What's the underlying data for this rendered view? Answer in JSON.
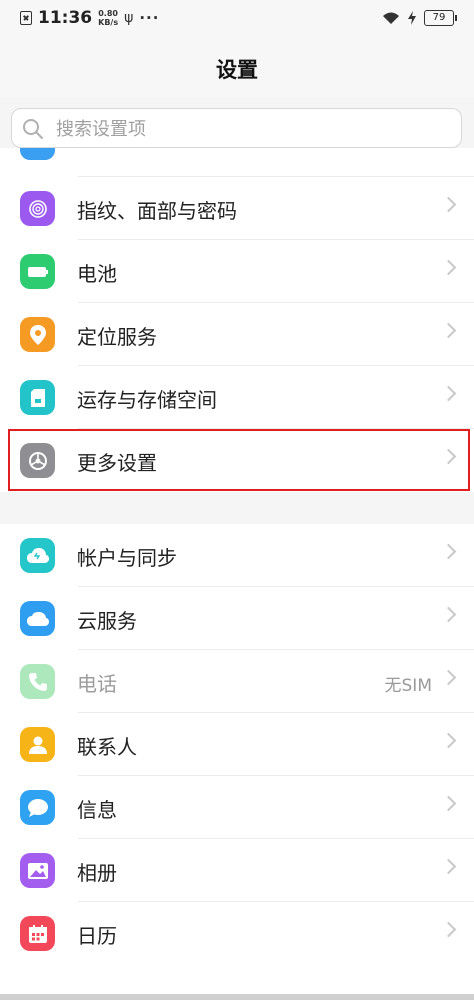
{
  "status_bar": {
    "time": "11:36",
    "speed_value": "0.80",
    "speed_unit": "KB/s",
    "battery": "79",
    "more_indicator": "···"
  },
  "header": {
    "title": "设置"
  },
  "search": {
    "placeholder": "搜索设置项"
  },
  "group1": [
    {
      "label": "指纹、面部与密码",
      "icon": "fingerprint-icon",
      "color": "#9b59f0"
    },
    {
      "label": "电池",
      "icon": "battery-icon",
      "color": "#2ecc71"
    },
    {
      "label": "定位服务",
      "icon": "location-icon",
      "color": "#f59a23"
    },
    {
      "label": "运存与存储空间",
      "icon": "storage-icon",
      "color": "#22c3c9"
    },
    {
      "label": "更多设置",
      "icon": "gear-icon",
      "color": "#8e8e93"
    }
  ],
  "group2": [
    {
      "label": "帐户与同步",
      "icon": "account-sync-icon",
      "color": "#25c6c9"
    },
    {
      "label": "云服务",
      "icon": "cloud-icon",
      "color": "#2f9ef0"
    },
    {
      "label": "电话",
      "icon": "phone-icon",
      "color": "#34c759",
      "value": "无SIM",
      "disabled": true
    },
    {
      "label": "联系人",
      "icon": "contacts-icon",
      "color": "#f7b416"
    },
    {
      "label": "信息",
      "icon": "message-icon",
      "color": "#2fa3f2"
    },
    {
      "label": "相册",
      "icon": "album-icon",
      "color": "#a35ef0"
    },
    {
      "label": "日历",
      "icon": "calendar-icon",
      "color": "#f2485a"
    }
  ],
  "colors": {
    "highlight": "#e02020",
    "background": "#f5f5f5"
  }
}
